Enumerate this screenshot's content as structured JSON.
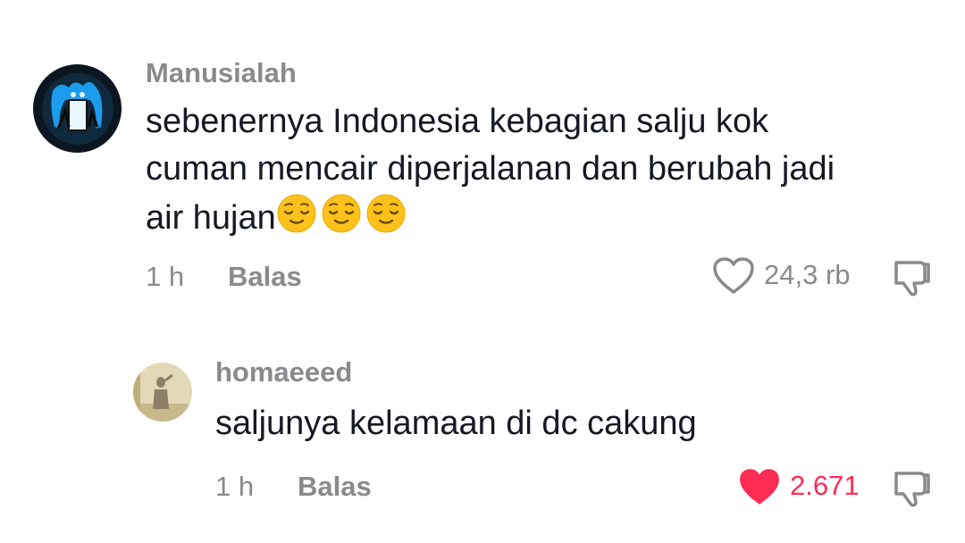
{
  "comments": [
    {
      "username": "Manusialah",
      "text_lines": [
        "sebenernya Indonesia kebagian salju kok",
        "cuman mencair diperjalanan dan berubah jadi",
        "air hujan"
      ],
      "emoji": "relieved-face",
      "emoji_count": 3,
      "time": "1 h",
      "reply_label": "Balas",
      "like_count": "24,3 rb",
      "liked": false
    },
    {
      "username": "homaeeed",
      "text_lines": [
        "saljunya kelamaan di dc cakung"
      ],
      "time": "1 h",
      "reply_label": "Balas",
      "like_count": "2.671",
      "liked": true
    }
  ],
  "colors": {
    "text": "#161823",
    "muted": "#8a8a8e",
    "like_active": "#fe2c55"
  }
}
